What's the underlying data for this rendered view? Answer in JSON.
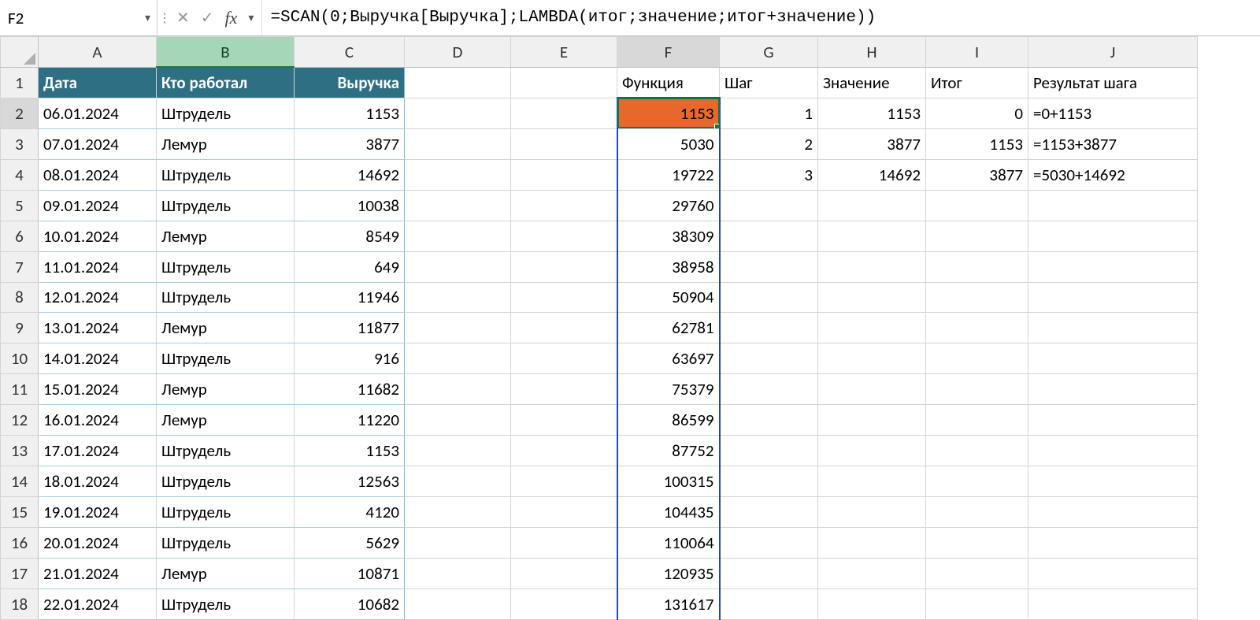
{
  "nameBox": "F2",
  "formula": "=SCAN(0;Выручка[Выручка];LAMBDA(итог;значение;итог+значение))",
  "columns": [
    "A",
    "B",
    "C",
    "D",
    "E",
    "F",
    "G",
    "H",
    "I",
    "J"
  ],
  "colWidths": {
    "A": 150,
    "B": 175,
    "C": 140,
    "D": 135,
    "E": 135,
    "F": 130,
    "G": 125,
    "H": 137,
    "I": 130,
    "J": 215
  },
  "headerRow": {
    "A": "Дата",
    "B": "Кто работал",
    "C": "Выручка",
    "F": "Функция",
    "G": "Шаг",
    "H": "Значение",
    "I": "Итог",
    "J": "Результат шага"
  },
  "dataRows": [
    {
      "row": 2,
      "A": "06.01.2024",
      "B": "Штрудель",
      "C": "1153",
      "F": "1153",
      "G": "1",
      "H": "1153",
      "I": "0",
      "J": "=0+1153"
    },
    {
      "row": 3,
      "A": "07.01.2024",
      "B": "Лемур",
      "C": "3877",
      "F": "5030",
      "G": "2",
      "H": "3877",
      "I": "1153",
      "J": "=1153+3877"
    },
    {
      "row": 4,
      "A": "08.01.2024",
      "B": "Штрудель",
      "C": "14692",
      "F": "19722",
      "G": "3",
      "H": "14692",
      "I": "3877",
      "J": "=5030+14692"
    },
    {
      "row": 5,
      "A": "09.01.2024",
      "B": "Штрудель",
      "C": "10038",
      "F": "29760"
    },
    {
      "row": 6,
      "A": "10.01.2024",
      "B": "Лемур",
      "C": "8549",
      "F": "38309"
    },
    {
      "row": 7,
      "A": "11.01.2024",
      "B": "Штрудель",
      "C": "649",
      "F": "38958"
    },
    {
      "row": 8,
      "A": "12.01.2024",
      "B": "Штрудель",
      "C": "11946",
      "F": "50904"
    },
    {
      "row": 9,
      "A": "13.01.2024",
      "B": "Лемур",
      "C": "11877",
      "F": "62781"
    },
    {
      "row": 10,
      "A": "14.01.2024",
      "B": "Штрудель",
      "C": "916",
      "F": "63697"
    },
    {
      "row": 11,
      "A": "15.01.2024",
      "B": "Лемур",
      "C": "11682",
      "F": "75379"
    },
    {
      "row": 12,
      "A": "16.01.2024",
      "B": "Лемур",
      "C": "11220",
      "F": "86599"
    },
    {
      "row": 13,
      "A": "17.01.2024",
      "B": "Штрудель",
      "C": "1153",
      "F": "87752"
    },
    {
      "row": 14,
      "A": "18.01.2024",
      "B": "Штрудель",
      "C": "12563",
      "F": "100315"
    },
    {
      "row": 15,
      "A": "19.01.2024",
      "B": "Штрудель",
      "C": "4120",
      "F": "104435"
    },
    {
      "row": 16,
      "A": "20.01.2024",
      "B": "Штрудель",
      "C": "5629",
      "F": "110064"
    },
    {
      "row": 17,
      "A": "21.01.2024",
      "B": "Лемур",
      "C": "10871",
      "F": "120935"
    },
    {
      "row": 18,
      "A": "22.01.2024",
      "B": "Штрудель",
      "C": "10682",
      "F": "131617"
    }
  ],
  "activeCell": {
    "row": 2,
    "col": "F"
  }
}
